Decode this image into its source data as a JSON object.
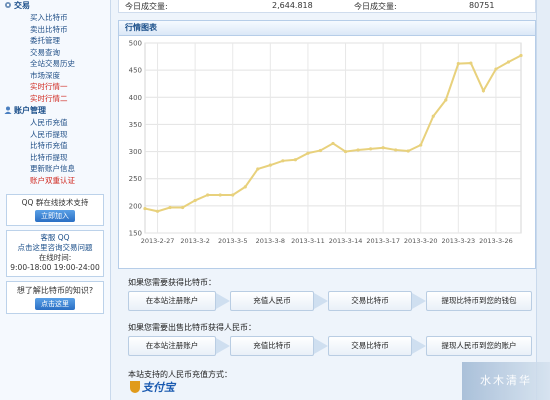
{
  "sidebar": {
    "trade_title": "交易",
    "trade_items": [
      {
        "label": "买入比特币",
        "red": false
      },
      {
        "label": "卖出比特币",
        "red": false
      },
      {
        "label": "委托管理",
        "red": false
      },
      {
        "label": "交易查询",
        "red": false
      },
      {
        "label": "全站交易历史",
        "red": false
      },
      {
        "label": "市场深度",
        "red": false
      },
      {
        "label": "实时行情一",
        "red": true
      },
      {
        "label": "实时行情二",
        "red": true
      }
    ],
    "account_title": "账户管理",
    "account_items": [
      {
        "label": "人民币充值",
        "red": false
      },
      {
        "label": "人民币提现",
        "red": false
      },
      {
        "label": "比特币充值",
        "red": false
      },
      {
        "label": "比特币提现",
        "red": false
      },
      {
        "label": "更新账户信息",
        "red": false
      },
      {
        "label": "账户双重认证",
        "red": true
      }
    ],
    "qq_group": {
      "title": "QQ 群在线技术支持",
      "button": "立即加入"
    },
    "service": {
      "title": "客服 QQ",
      "desc": "点击这里咨询交易问题",
      "hours_label": "在线时间:",
      "hours": "9:00-18:00 19:00-24:00"
    },
    "learn": {
      "title": "想了解比特币的知识?",
      "button": "点击这里"
    }
  },
  "stats": {
    "today_volume_label": "今日成交量:",
    "today_volume_value": "2,644.818",
    "today_count_label": "今日成交量:",
    "today_count_value": "80751"
  },
  "chart_panel_title": "行情图表",
  "chart_data": {
    "type": "line",
    "title": "",
    "xlabel": "",
    "ylabel": "",
    "ylim": [
      150,
      500
    ],
    "yticks": [
      150,
      200,
      250,
      300,
      350,
      400,
      450,
      500
    ],
    "xtick_labels": [
      "2013-2-27",
      "2013-3-2",
      "2013-3-5",
      "2013-3-8",
      "2013-3-11",
      "2013-3-14",
      "2013-3-17",
      "2013-3-20",
      "2013-3-23",
      "2013-3-26"
    ],
    "grid": true,
    "color": "#e8d17c",
    "series": [
      {
        "values": [
          195,
          190,
          197,
          197,
          210,
          220,
          220,
          220,
          235,
          268,
          275,
          283,
          285,
          297,
          302,
          315,
          300,
          303,
          305,
          307,
          303,
          301,
          312,
          365,
          395,
          462,
          463,
          412,
          452,
          465,
          477
        ]
      }
    ]
  },
  "buy_flow": {
    "title": "如果您需要获得比特币：",
    "steps": [
      "在本站注册账户",
      "充值人民币",
      "交易比特币",
      "提现比特币到您的钱包"
    ]
  },
  "sell_flow": {
    "title": "如果您需要出售比特币获得人民币：",
    "steps": [
      "在本站注册账户",
      "充值比特币",
      "交易比特币",
      "提现人民币到您的账户"
    ]
  },
  "payment": {
    "title": "本站支持的人民币充值方式：",
    "alipay_logo": "支付宝"
  },
  "watermark": "水木清华"
}
